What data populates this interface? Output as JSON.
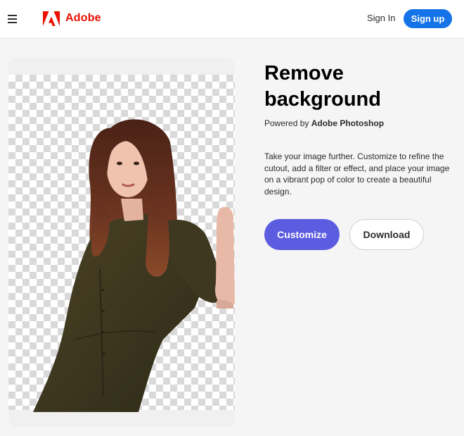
{
  "header": {
    "brand": "Adobe",
    "sign_in": "Sign In",
    "sign_up": "Sign up",
    "brand_color": "#eb1000",
    "primary_color": "#1473e6"
  },
  "hero": {
    "title": "Remove background",
    "powered_prefix": "Powered by",
    "powered_product": "Adobe Photoshop",
    "description": "Take your image further. Customize to refine the cutout, add a filter or effect, and place your image on a vibrant pop of color to create a beautiful design.",
    "customize_label": "Customize",
    "download_label": "Download",
    "customize_color": "#5c5ce0"
  },
  "icons": {
    "menu": "hamburger-menu-icon",
    "logo": "adobe-logo-icon"
  }
}
